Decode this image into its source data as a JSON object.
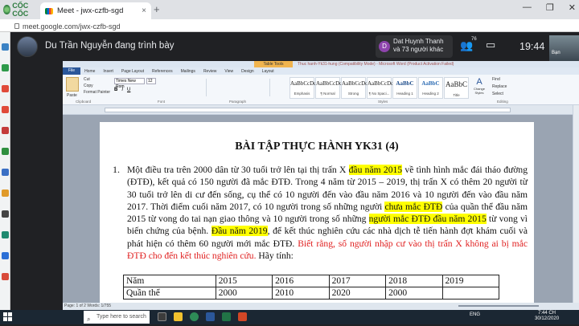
{
  "browser": {
    "brand": "CỐC CỐC",
    "tab_title": "Meet - jwx-czfb-sgd",
    "tab_close": "×",
    "new_tab": "+",
    "url": "meet.google.com/jwx-czfb-sgd",
    "window_controls": [
      "—",
      "❐",
      "✕"
    ]
  },
  "meet": {
    "presenter_text": "Du Trần Nguyễn đang trình bày",
    "viewer_initial": "D",
    "viewer_name": "Dat Huynh Thanh",
    "viewer_others": "và 73 người khác",
    "participant_count": "76",
    "time": "19:44",
    "self_label": "Bạn"
  },
  "word": {
    "table_tools_label": "Table Tools",
    "doc_title": "Thuc hanh-Yk31-hung (Compatibility Mode) - Microsoft Word (Product Activation Failed)",
    "menu": [
      "File",
      "Home",
      "Insert",
      "Page Layout",
      "References",
      "Mailings",
      "Review",
      "View",
      "Design",
      "Layout"
    ],
    "ribbon": {
      "paste": "Paste",
      "cut": "Cut",
      "copy": "Copy",
      "format_painter": "Format Painter",
      "clipboard": "Clipboard",
      "font_name": "Times New Rom",
      "font_size": "12",
      "font_group": "Font",
      "paragraph_group": "Paragraph",
      "styles_group": "Styles",
      "editing_group": "Editing",
      "styles": [
        {
          "preview": "AaBbCcDc",
          "name": "Emphasis"
        },
        {
          "preview": "AaBbCcDc",
          "name": "¶ Normal"
        },
        {
          "preview": "AaBbCcDc",
          "name": "Strong"
        },
        {
          "preview": "AaBbCcDc",
          "name": "¶ No Spaci..."
        },
        {
          "preview": "AaBbC",
          "name": "Heading 1"
        },
        {
          "preview": "AaBbC",
          "name": "Heading 2"
        },
        {
          "preview": "AaBbC",
          "name": "Title"
        }
      ],
      "change_styles": "Change Styles",
      "find": "Find",
      "replace": "Replace",
      "select": "Select"
    },
    "heading": "BÀI TẬP THỰC HÀNH YK31 (4)",
    "item_number": "1.",
    "paragraph": [
      {
        "t": "Một điều tra trên 2000 dân từ 30 tuổi trở lên tại thị trấn X ",
        "s": ""
      },
      {
        "t": "đầu năm 2015",
        "s": "hl"
      },
      {
        "t": " về tình hình mắc đái tháo đường (ĐTĐ), kết quả có 150 người đã mắc ĐTĐ. Trong 4 năm từ 2015 – 2019, thị trấn X có thêm 20 người từ 30 tuổi trở lên di cư đến sống, cụ thể có 10 người đến vào đầu năm 2016 và 10 người đến vào đầu năm 2017. Thời điểm cuối năm 2017, có 10 người trong số những người ",
        "s": ""
      },
      {
        "t": "chưa mắc ĐTĐ",
        "s": "hl"
      },
      {
        "t": " của quần thể đầu năm 2015 từ vong do tai nạn giao thông và 10 người trong số những ",
        "s": ""
      },
      {
        "t": "người mắc ĐTĐ đầu năm 2015",
        "s": "hl"
      },
      {
        "t": " từ vong vì biến chứng của bệnh. ",
        "s": ""
      },
      {
        "t": "Đầu năm 2019",
        "s": "hl"
      },
      {
        "t": ", để kết thúc nghiên cứu các nhà dịch tễ tiến hành đợt khám cuối và phát hiện có thêm 60 người mới mắc ĐTĐ. ",
        "s": ""
      },
      {
        "t": "Biết rằng, số người nhập cư vào thị trấn X không ai bị mắc ĐTĐ cho đến kết thúc nghiên cứu.",
        "s": "red"
      },
      {
        "t": " Hãy tính:",
        "s": ""
      }
    ],
    "table": [
      [
        "Năm",
        "2015",
        "2016",
        "2017",
        "2018",
        "2019"
      ],
      [
        "Quần thể",
        "2000",
        "2010",
        "2020",
        "2000",
        ""
      ]
    ],
    "status": "Page: 1 of 2   Words: 1/755"
  },
  "taskbar": {
    "search_placeholder": "Type here to search",
    "tray_lang": "ENG",
    "tray_time": "7:44 CH",
    "tray_date": "30/12/2020"
  }
}
